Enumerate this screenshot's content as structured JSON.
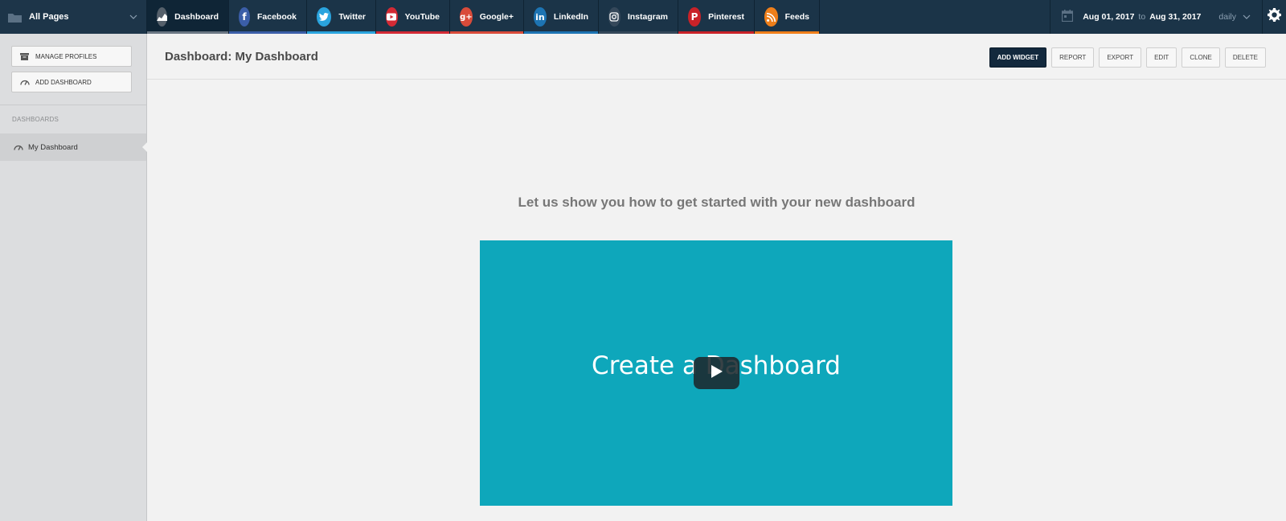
{
  "topbar": {
    "pages_label": "All Pages",
    "networks": [
      {
        "label": "Dashboard",
        "icon": "chart-icon",
        "color": "#55606b",
        "bar": "#6b7784",
        "glyph": ""
      },
      {
        "label": "Facebook",
        "icon": "facebook-icon",
        "color": "#3b5ea8",
        "bar": "#3b5ea8",
        "glyph": "f"
      },
      {
        "label": "Twitter",
        "icon": "twitter-icon",
        "color": "#2aa4de",
        "bar": "#2aa4de",
        "glyph": ""
      },
      {
        "label": "YouTube",
        "icon": "youtube-icon",
        "color": "#d32a35",
        "bar": "#d32a35",
        "glyph": ""
      },
      {
        "label": "Google+",
        "icon": "google-plus-icon",
        "color": "#d94b3a",
        "bar": "#d94b3a",
        "glyph": "g+"
      },
      {
        "label": "LinkedIn",
        "icon": "linkedin-icon",
        "color": "#1d74b3",
        "bar": "#1d74b3",
        "glyph": "in"
      },
      {
        "label": "Instagram",
        "icon": "instagram-icon",
        "color": "#35485a",
        "bar": "#35485a",
        "glyph": ""
      },
      {
        "label": "Pinterest",
        "icon": "pinterest-icon",
        "color": "#c92228",
        "bar": "#c92228",
        "glyph": "P"
      },
      {
        "label": "Feeds",
        "icon": "rss-icon",
        "color": "#ef7f1a",
        "bar": "#ef7f1a",
        "glyph": ""
      }
    ],
    "date_from": "Aug 01, 2017",
    "date_to_sep": "to",
    "date_to": "Aug 31, 2017",
    "frequency": "daily"
  },
  "sidebar": {
    "manage_profiles": "MANAGE PROFILES",
    "add_dashboard": "ADD DASHBOARD",
    "section_label": "DASHBOARDS",
    "items": [
      {
        "label": "My Dashboard"
      }
    ]
  },
  "main": {
    "title": "Dashboard: My Dashboard",
    "actions": {
      "add_widget": "ADD WIDGET",
      "report": "REPORT",
      "export": "EXPORT",
      "edit": "EDIT",
      "clone": "CLONE",
      "delete": "DELETE"
    },
    "headline": "Let us show you how to get started with your new dashboard",
    "video_title": "Create a Dashboard"
  }
}
